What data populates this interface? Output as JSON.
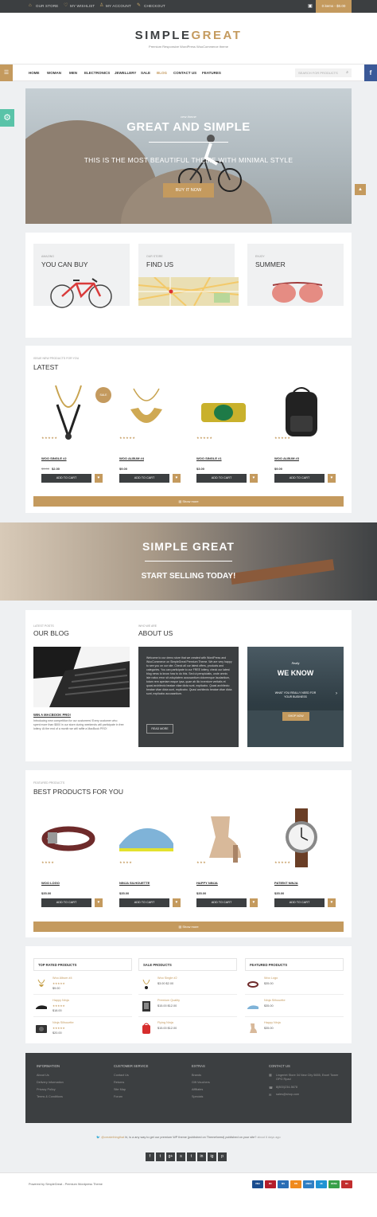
{
  "topbar": {
    "store": "OUR STORE",
    "wishlist": "MY WISHLIST",
    "account": "MY ACCOUNT",
    "checkout": "CHECKOUT",
    "cart": "0 items - $0.00"
  },
  "brand": {
    "name_a": "SIMPLE",
    "name_b": "GREAT",
    "tagline": "Premium Responsive WordPress WooCommerce theme"
  },
  "nav": {
    "items": [
      "HOME",
      "WOMAN",
      "MEN",
      "ELECTRONICS",
      "JEWELLERY",
      "SALE",
      "BLOG",
      "CONTACT US",
      "FEATURES"
    ],
    "active": "BLOG",
    "search_placeholder": "SEARCH FOR PRODUCTS"
  },
  "hero": {
    "kicker": "new theme",
    "title": "GREAT AND SIMPLE",
    "subtitle": "THIS IS THE MOST BEAUTIFUL THEME WITH MINIMAL STYLE",
    "button": "BUY IT NOW"
  },
  "promos": [
    {
      "small": "AMAZING",
      "title": "YOU CAN BUY"
    },
    {
      "small": "OUR STORE",
      "title": "FIND US"
    },
    {
      "small": "ENJOY",
      "title": "SUMMER"
    }
  ],
  "latest": {
    "small": "ISSUE NEW PRODUCTS FOR YOU",
    "title": "LATEST",
    "show_more": "Show more",
    "sale_badge": "SALE",
    "products": [
      {
        "name": "WOO SINGLE #2",
        "old_price": "$3.00",
        "price": "$2.00",
        "stars": "★★★★★"
      },
      {
        "name": "WOO ALBUM #4",
        "old_price": "",
        "price": "$9.00",
        "stars": "★★★★★"
      },
      {
        "name": "WOO SINGLE #1",
        "old_price": "",
        "price": "$3.00",
        "stars": "★★★★★"
      },
      {
        "name": "WOO ALBUM #3",
        "old_price": "",
        "price": "$9.00",
        "stars": "★★★★★"
      }
    ]
  },
  "add_to_cart": "ADD TO CART",
  "banner": {
    "title": "SIMPLE GREAT",
    "subtitle": "START SELLING TODAY!"
  },
  "blog": {
    "small": "LATEST POSTS",
    "title": "OUR BLOG",
    "post_title": "WIN A MACBOOK PRO!",
    "post_text": "Introducing new competition for our customers! Every customer who spent more than $500 in our store during weekends will participate in free lottery. At the end of a month we will raffle a MacBook PRO!"
  },
  "about": {
    "small": "WHO WE ARE",
    "title": "ABOUT US",
    "text": "Welcome to our demo store that we created with WordPress and WooCommerce on SimpleGreat Premium Theme. We are very happy to see you on our site. Check all our latest offers, products and categories. You can participate to our FREE lottery, check our latest blog news to know how to do this. Sed ut perspiciatis, unde omnis iste natus error sit voluptatem accusantium doloremque laudantium, totam rem aperiam eaque ipsa, quae ab illo inventore veritatis et quasi architecto beatae vitae dicta sunt, explicabo. Quasi architecto beatae vitae dicta sunt, explicabo. Quasi architecto beatae vitae dicta sunt, explicabo accusantium.",
    "button": "READ MORE"
  },
  "weknow": {
    "kicker": "Really",
    "title": "WE KNOW",
    "text": "WHAT YOU REALLY NEED FOR YOUR BUSINESS",
    "button": "SHOP NOW"
  },
  "best": {
    "small": "FEATURED PRODUCTS",
    "title": "BEST PRODUCTS FOR YOU",
    "show_more": "Show more",
    "products": [
      {
        "name": "WOO LOGO",
        "price": "$35.00",
        "stars": "★★★★"
      },
      {
        "name": "NINJA SILHOUETTE",
        "price": "$35.00",
        "stars": "★★★★"
      },
      {
        "name": "HAPPY NINJA",
        "price": "$35.00",
        "stars": "★★★"
      },
      {
        "name": "PATIENT NINJA",
        "price": "$35.00",
        "stars": "★★★★★"
      }
    ]
  },
  "lists": [
    {
      "title": "TOP RATED PRODUCTS",
      "items": [
        {
          "name": "Woo Album #4",
          "stars": "★★★★★",
          "price": "$9.00"
        },
        {
          "name": "Happy Ninja",
          "stars": "★★★★★",
          "price": "$18.00"
        },
        {
          "name": "Ninja Silhouette",
          "stars": "★★★★★",
          "price": "$20.00"
        }
      ]
    },
    {
      "title": "SALE PRODUCTS",
      "items": [
        {
          "name": "Woo Single #2",
          "stars": "",
          "price": "$3.00 $2.00"
        },
        {
          "name": "Premium Quality",
          "stars": "",
          "price": "$15.00 $12.00"
        },
        {
          "name": "Flying Ninja",
          "stars": "",
          "price": "$15.00 $12.00"
        }
      ]
    },
    {
      "title": "FEATURED PRODUCTS",
      "items": [
        {
          "name": "Woo Logo",
          "stars": "",
          "price": "$35.00"
        },
        {
          "name": "Ninja Silhouette",
          "stars": "",
          "price": "$35.00"
        },
        {
          "name": "Happy Ninja",
          "stars": "",
          "price": "$35.00"
        }
      ]
    }
  ],
  "footer": {
    "information": {
      "title": "INFORMATION",
      "items": [
        "About Us",
        "Delivery Information",
        "Privacy Policy",
        "Terms & Conditions"
      ]
    },
    "service": {
      "title": "CUSTOMER SERVICE",
      "items": [
        "Contact Us",
        "Returns",
        "Site Map",
        "Forum"
      ]
    },
    "extras": {
      "title": "EXTRAS",
      "items": [
        "Brands",
        "Gift Vouchers",
        "Affiliates",
        "Specials"
      ]
    },
    "contact": {
      "title": "CONTACT US",
      "items": [
        "Lingeriet Store 34 New City 5655, Excel Tower OPG Rpad",
        "8(800)234-5678",
        "sales@shop.com"
      ]
    }
  },
  "tweet": {
    "handle": "@createthingthat",
    "text": "hi, is a any way to get our premium WP theme (published on Themeforest) published on your site?",
    "time": "about 6 days ago"
  },
  "social": [
    "f",
    "t",
    "g+",
    "s",
    "t",
    "in",
    "ig",
    "p"
  ],
  "copyright": "Powered by SimpleGreat - Premium Wordpress Theme",
  "payments": [
    "VISA",
    "MC",
    "MS",
    "DIS",
    "AMEX",
    "AE",
    "BKNG",
    "MC"
  ]
}
